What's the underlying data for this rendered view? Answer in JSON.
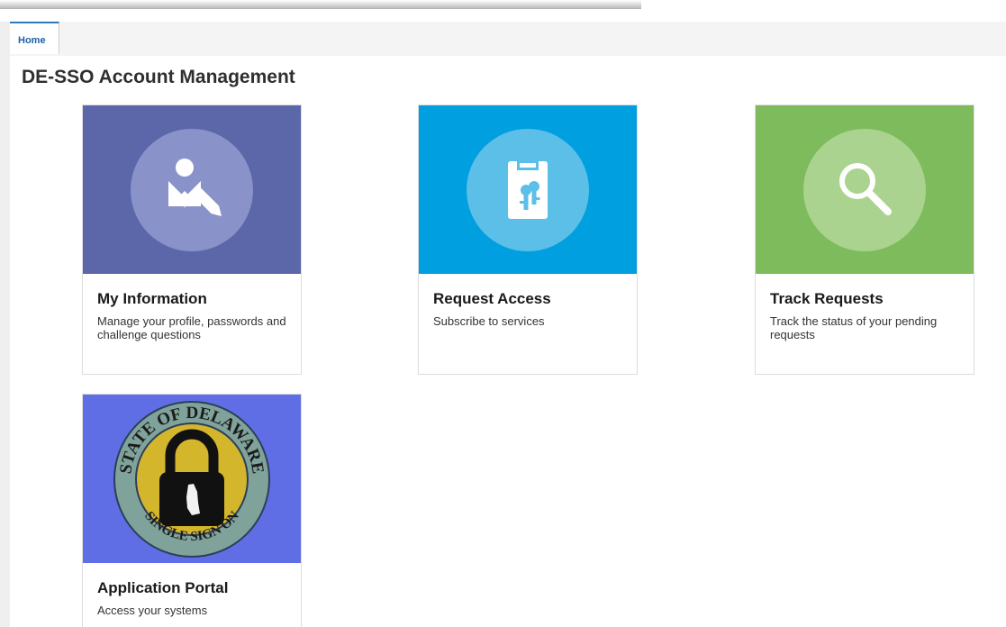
{
  "tabs": [
    {
      "label": "Home",
      "active": true
    }
  ],
  "page_title": "DE-SSO Account Management",
  "tiles": [
    {
      "title": "My Information",
      "description": "Manage your profile, passwords and challenge questions",
      "icon": "user-edit-icon",
      "color": "#5b67a9"
    },
    {
      "title": "Request Access",
      "description": "Subscribe to services",
      "icon": "clipboard-keys-icon",
      "color": "#009fe0"
    },
    {
      "title": "Track Requests",
      "description": "Track the status of your pending requests",
      "icon": "magnifier-icon",
      "color": "#7dbb5c"
    },
    {
      "title": "Application Portal",
      "description": "Access your systems",
      "icon": "padlock-seal-icon",
      "color": "#5f6ee4"
    }
  ],
  "seal": {
    "top_text": "STATE OF DELAWARE",
    "bottom_text": "SINGLE SIGN ON"
  }
}
